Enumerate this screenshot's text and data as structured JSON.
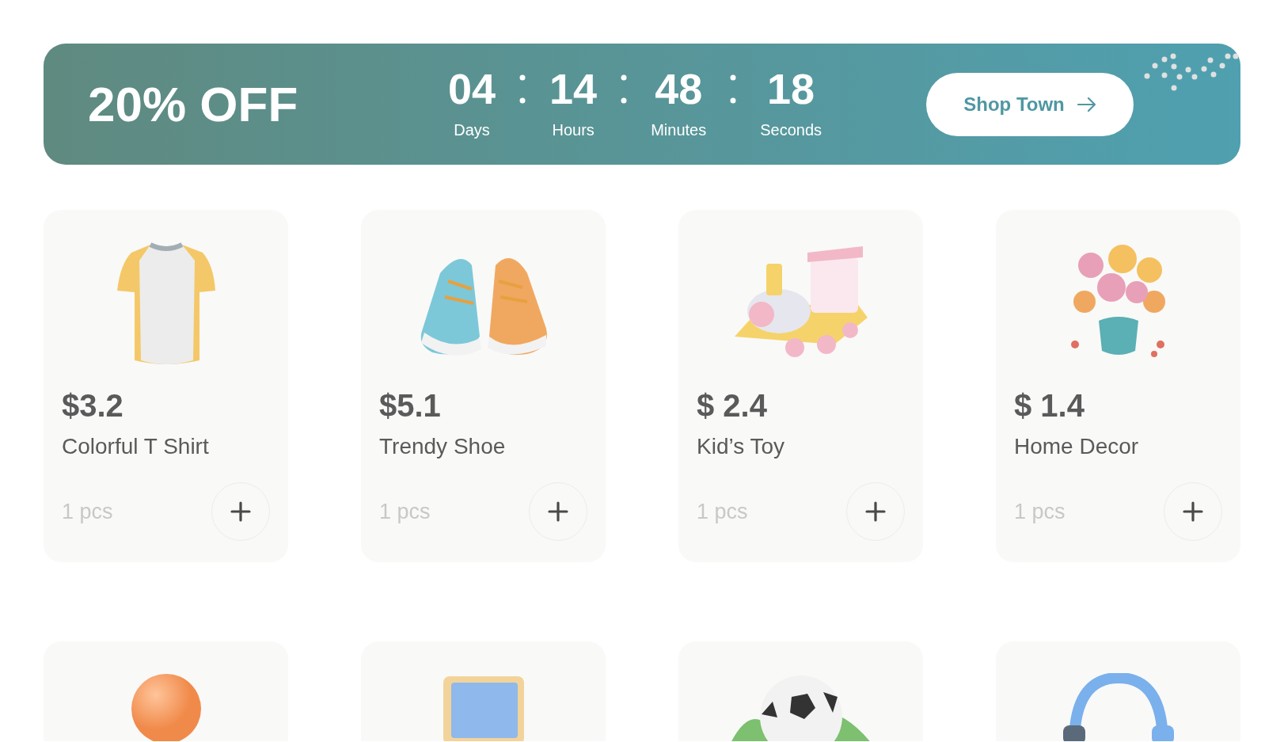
{
  "banner": {
    "headline": "20% OFF",
    "countdown": [
      {
        "value": "04",
        "unit": "Days"
      },
      {
        "value": "14",
        "unit": "Hours"
      },
      {
        "value": "48",
        "unit": "Minutes"
      },
      {
        "value": "18",
        "unit": "Seconds"
      }
    ],
    "button": "Shop Town"
  },
  "products": [
    {
      "kind": "tshirt",
      "price": "$3.2",
      "name": "Colorful T Shirt",
      "quantity": "1 pcs"
    },
    {
      "kind": "sneakers",
      "price": "$5.1",
      "name": "Trendy Shoe",
      "quantity": "1 pcs"
    },
    {
      "kind": "train",
      "price": "$ 2.4",
      "name": "Kid’s Toy",
      "quantity": "1 pcs"
    },
    {
      "kind": "flowers",
      "price": "$ 1.4",
      "name": "Home Decor",
      "quantity": "1 pcs"
    },
    {
      "kind": "ball"
    },
    {
      "kind": "monitor"
    },
    {
      "kind": "soccer"
    },
    {
      "kind": "headphones"
    }
  ]
}
